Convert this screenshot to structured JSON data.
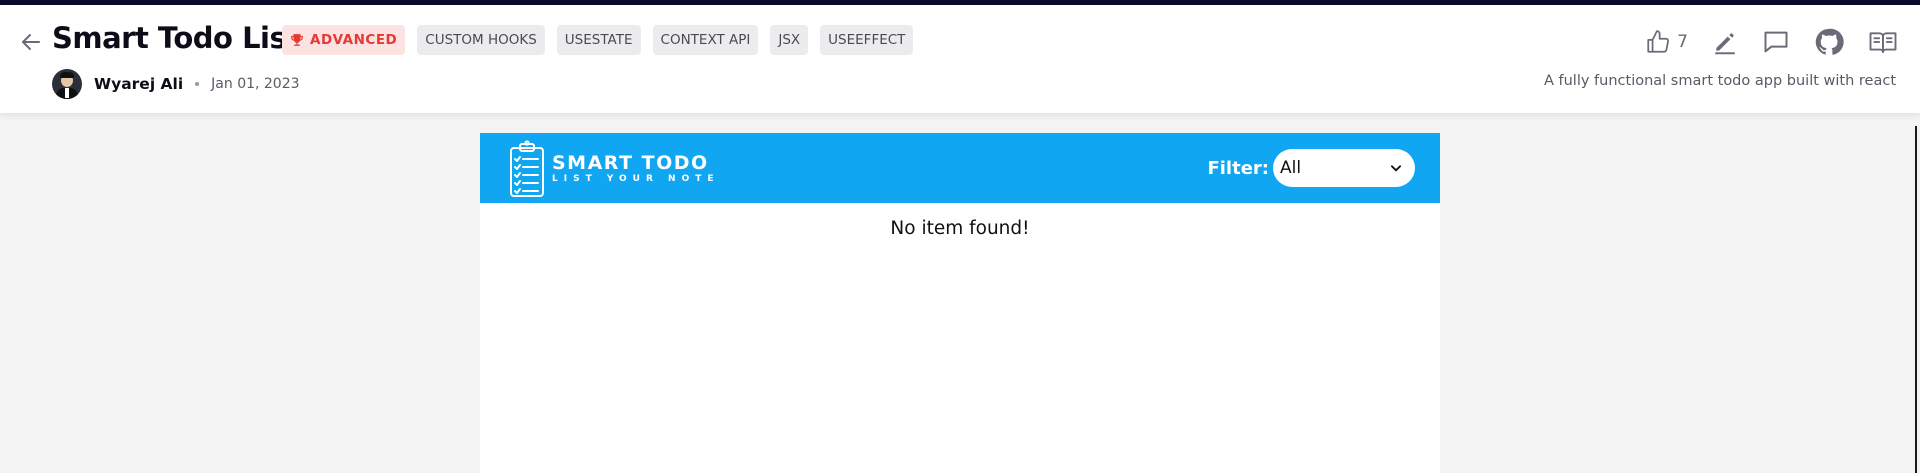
{
  "header": {
    "title": "Smart Todo List",
    "level_badge": "ADVANCED",
    "tags": [
      "CUSTOM HOOKS",
      "USESTATE",
      "CONTEXT API",
      "JSX",
      "USEEFFECT"
    ],
    "author": "Wyarej Ali",
    "date": "Jan 01, 2023",
    "likes": "7",
    "description": "A fully functional smart todo app built with react",
    "icons": {
      "back": "arrow-left-icon",
      "badge": "trophy-icon",
      "like": "thumbs-up-icon",
      "edit": "pencil-icon",
      "comment": "comment-icon",
      "github": "github-icon",
      "docs": "book-icon"
    }
  },
  "app": {
    "logo_title": "SMART TODO",
    "logo_subtitle": "LIST YOUR NOTE",
    "filter_label": "Filter:",
    "filter_value": "All",
    "empty_message": "No item found!",
    "colors": {
      "header_bg": "#10a6f2",
      "badge_bg": "#fde2e2",
      "badge_text": "#e53935"
    }
  }
}
